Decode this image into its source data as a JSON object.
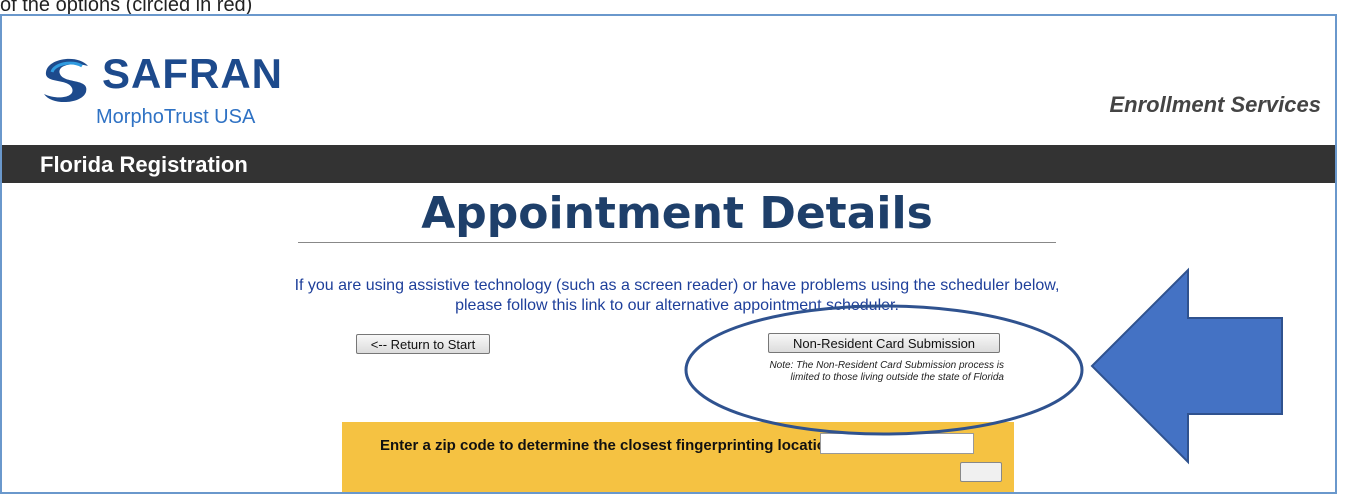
{
  "caption": "of the options (circled in red)",
  "header": {
    "brand_name": "SAFRAN",
    "brand_sub": "MorphoTrust USA",
    "service": "Enrollment Services",
    "bar_title": "Florida Registration"
  },
  "main": {
    "title": "Appointment Details",
    "assistive_line1": "If you are using assistive technology (such as a screen reader) or have problems using the scheduler below,",
    "assistive_line2": "please follow this link to our alternative appointment scheduler.",
    "return_button": "<-- Return to Start",
    "nonresident_button": "Non-Resident Card Submission",
    "note_line1": "Note: The Non-Resident Card Submission process is",
    "note_line2": "limited to those living outside the state of Florida",
    "zip_label": "Enter a zip code to determine the closest fingerprinting location.",
    "zip_value": ""
  },
  "colors": {
    "header_bar": "#333333",
    "title": "#1e3f6a",
    "zip_panel": "#f5c242",
    "annotation": "#4472c4",
    "annotation_stroke": "#2f528f"
  },
  "icons": [
    "safran-logo-icon",
    "arrow-left-icon",
    "highlight-ellipse"
  ]
}
